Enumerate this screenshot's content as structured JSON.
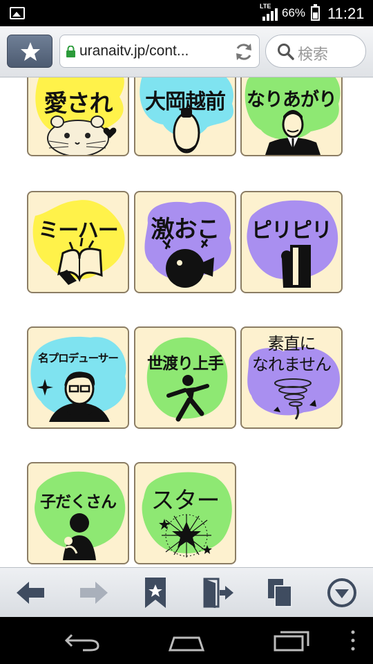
{
  "status_bar": {
    "network": "LTE",
    "battery_percent": "66%",
    "battery_level": 0.66,
    "time": "11:21"
  },
  "browser": {
    "url": "uranaitv.jp/cont...",
    "search_placeholder": "検索"
  },
  "tiles": [
    {
      "label": "愛され",
      "blob_color": "#fff24a",
      "picture": "hamster-icon"
    },
    {
      "label": "大岡越前",
      "blob_color": "#7fe3f0",
      "picture": "samurai-head-icon"
    },
    {
      "label": "なりあがり",
      "blob_color": "#8ee873",
      "picture": "businessman-icon"
    },
    {
      "label": "ミーハー",
      "blob_color": "#fff24a",
      "picture": "book-icon"
    },
    {
      "label": "激おこ",
      "blob_color": "#a98ff0",
      "picture": "pufferfish-icon"
    },
    {
      "label": "ピリピリ",
      "blob_color": "#a98ff0",
      "picture": "door-icon"
    },
    {
      "label": "名プロデューサー",
      "blob_color": "#7fe3f0",
      "picture": "producer-icon"
    },
    {
      "label": "世渡り上手",
      "blob_color": "#8ee873",
      "picture": "dancing-person-icon"
    },
    {
      "label": "素直に\nなれません",
      "line1": "素直に",
      "line2": "なれません",
      "blob_color": "#a98ff0",
      "picture": "tornado-icon"
    },
    {
      "label": "子だくさん",
      "blob_color": "#8ee873",
      "picture": "parent-child-icon"
    },
    {
      "label": "スター",
      "blob_color": "#8ee873",
      "picture": "star-burst-icon"
    }
  ],
  "bottom_bar": [
    "back-arrow-icon",
    "forward-arrow-icon",
    "bookmark-icon",
    "exit-door-icon",
    "tabs-icon",
    "menu-down-icon"
  ],
  "nav_bar": [
    "back-icon",
    "home-icon",
    "recents-icon",
    "overflow-menu-icon"
  ]
}
